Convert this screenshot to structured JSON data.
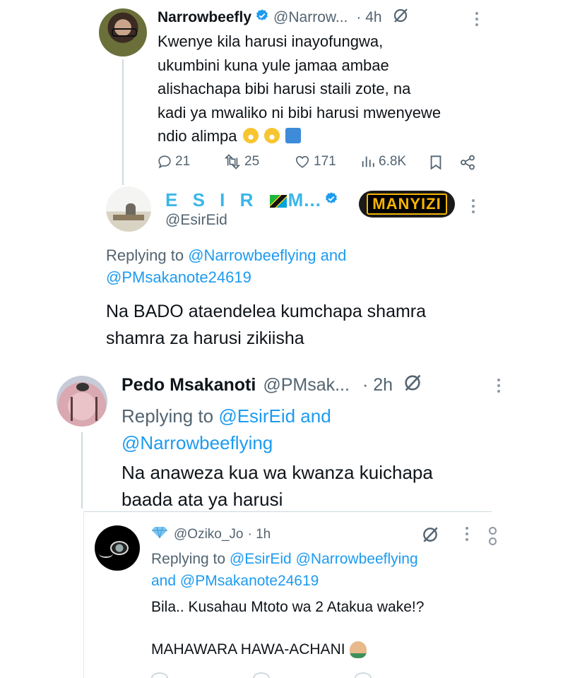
{
  "tweets": [
    {
      "name": "Narrowbeefly",
      "handle": "@Narrow...",
      "time": "· 4h",
      "text_lines": [
        "Kwenye kila harusi inayofungwa,",
        "ukumbini kuna yule jamaa ambae",
        "alishachapa bibi harusi staili zote, na",
        "kadi ya mwaliko ni bibi harusi mwenyewe",
        "ndio alimpa"
      ],
      "replies": "21",
      "reposts": "25",
      "likes": "171",
      "views": "6.8K"
    },
    {
      "name_part1": "E S I R",
      "name_part2": "M...",
      "handle": "@EsirEid",
      "badge": "MANYIZI",
      "replying_label": "Replying to",
      "replying_user1": "@Narrowbeeflying",
      "replying_and": "and",
      "replying_user2": "@PMsakanote24619",
      "text_lines": [
        "Na BADO ataendelea kumchapa shamra",
        "shamra za harusi zikiisha"
      ]
    },
    {
      "name": "Pedo Msakanoti",
      "handle": "@PMsak...",
      "time": "· 2h",
      "replying_label": "Replying to",
      "replying_user1": "@EsirEid",
      "replying_and": "and",
      "replying_user2": "@Narrowbeeflying",
      "text_lines": [
        "Na anaweza kua wa kwanza kuichapa",
        "baada ata ya harusi"
      ]
    },
    {
      "handle": "@Oziko_Jo",
      "time": "· 1h",
      "replying_label": "Replying to",
      "replying_user1": "@EsirEid",
      "replying_user2": "@Narrowbeeflying",
      "replying_and": "and",
      "replying_user3": "@PMsakanote24619",
      "text_line1": "Bila.. Kusahau Mtoto wa 2 Atakua wake!?",
      "text_line2": "MAHAWARA HAWA-ACHANI"
    }
  ],
  "colors": {
    "accent": "#1d9bf0",
    "muted": "#536471",
    "thread_line": "#cfd9de",
    "badge_bg": "#1a1a1a",
    "badge_text": "#f5b400"
  },
  "icons": [
    "verified-icon",
    "grok-icon",
    "more-icon",
    "reply-icon",
    "repost-icon",
    "like-icon",
    "views-icon",
    "bookmark-icon",
    "share-icon",
    "flag-tanzania-icon",
    "diamond-icon"
  ]
}
